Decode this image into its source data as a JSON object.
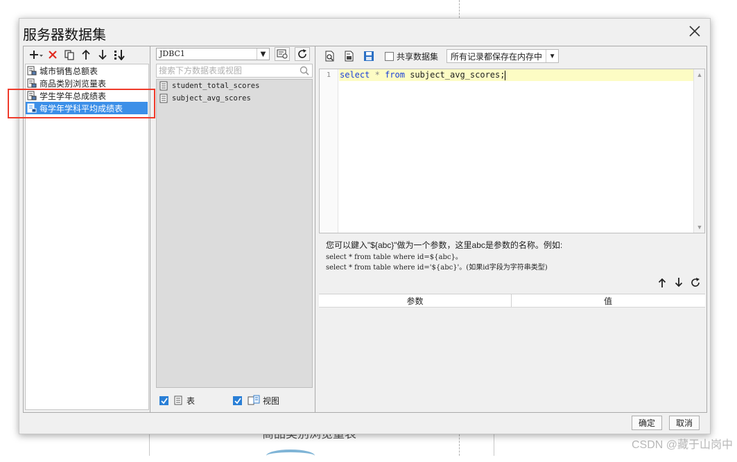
{
  "dialog": {
    "title": "服务器数据集",
    "ok_label": "确定",
    "cancel_label": "取消"
  },
  "left": {
    "items": [
      {
        "label": "城市销售总额表",
        "selected": false
      },
      {
        "label": "商品类别浏览量表",
        "selected": false
      },
      {
        "label": "学生学年总成绩表",
        "selected": false
      },
      {
        "label": "每学年学科平均成绩表",
        "selected": true
      }
    ]
  },
  "middle": {
    "connection": "JDBC1",
    "search_placeholder": "搜索下方数据表或视图",
    "tables": [
      "student_total_scores",
      "subject_avg_scores"
    ],
    "show_tables_label": "表",
    "show_views_label": "视图"
  },
  "right": {
    "share_label": "共享数据集",
    "mode": "所有记录都保存在内存中",
    "line_number": "1",
    "sql": {
      "kw_select": "select",
      "star": "*",
      "kw_from": "from",
      "rest": "subject_avg_scores;"
    },
    "hint_line1": "您可以鍵入\"${abc}\"做为一个参数，这里abc是参数的名称。例如:",
    "hint_line2": "select * from table where id=${abc}。",
    "hint_line3": "select * from table where id='${abc}'。(如果id字段为字符串类型)",
    "param_col": "参数",
    "value_col": "值"
  },
  "background": {
    "chart_title": "商品类别浏览量表",
    "watermark": "CSDN @藏于山岗中"
  },
  "colors": {
    "selection": "#3c8fe8",
    "highlight": "#ef3b2b",
    "keyword": "#1a3fd6",
    "editor_line": "#fdfcc4"
  }
}
